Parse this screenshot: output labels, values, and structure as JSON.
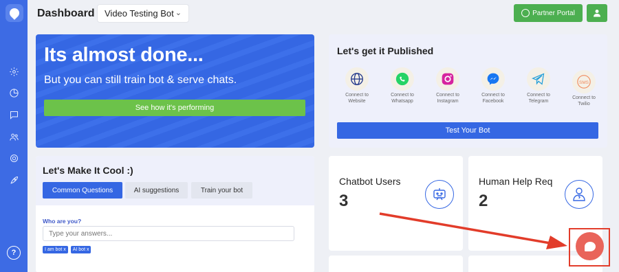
{
  "header": {
    "title": "Dashboard",
    "bot_name": "Video Testing Bot",
    "partner_label": "Partner Portal"
  },
  "hero": {
    "title": "Its almost done...",
    "subtitle": "But you can still train bot & serve chats.",
    "cta_label": "See how it's performing"
  },
  "publish": {
    "title": "Let's get it Published",
    "channels": [
      {
        "label": "Connect to Website",
        "icon": "globe-icon"
      },
      {
        "label": "Connect to Whatsapp",
        "icon": "whatsapp-icon"
      },
      {
        "label": "Connect to Instagram",
        "icon": "instagram-icon"
      },
      {
        "label": "Connect to Facebook",
        "icon": "messenger-icon"
      },
      {
        "label": "Connect to Telegram",
        "icon": "telegram-icon"
      },
      {
        "label": "Connect to Twilio",
        "icon": "sms-icon",
        "badge": "SMS"
      }
    ],
    "test_label": "Test Your Bot"
  },
  "cool": {
    "title": "Let's Make It Cool :)",
    "tabs": [
      "Common Questions",
      "AI suggestions",
      "Train your bot"
    ],
    "question": "Who are you?",
    "answer_placeholder": "Type your answers...",
    "chips": [
      "I am bot x",
      "AI bot x"
    ]
  },
  "stats": [
    {
      "title": "Chatbot Users",
      "value": "3"
    },
    {
      "title": "Human Help Req",
      "value": "2"
    }
  ],
  "colors": {
    "primary": "#3567e3",
    "green": "#4caf50",
    "chat": "#e9645a",
    "annotation": "#e23c2a"
  }
}
